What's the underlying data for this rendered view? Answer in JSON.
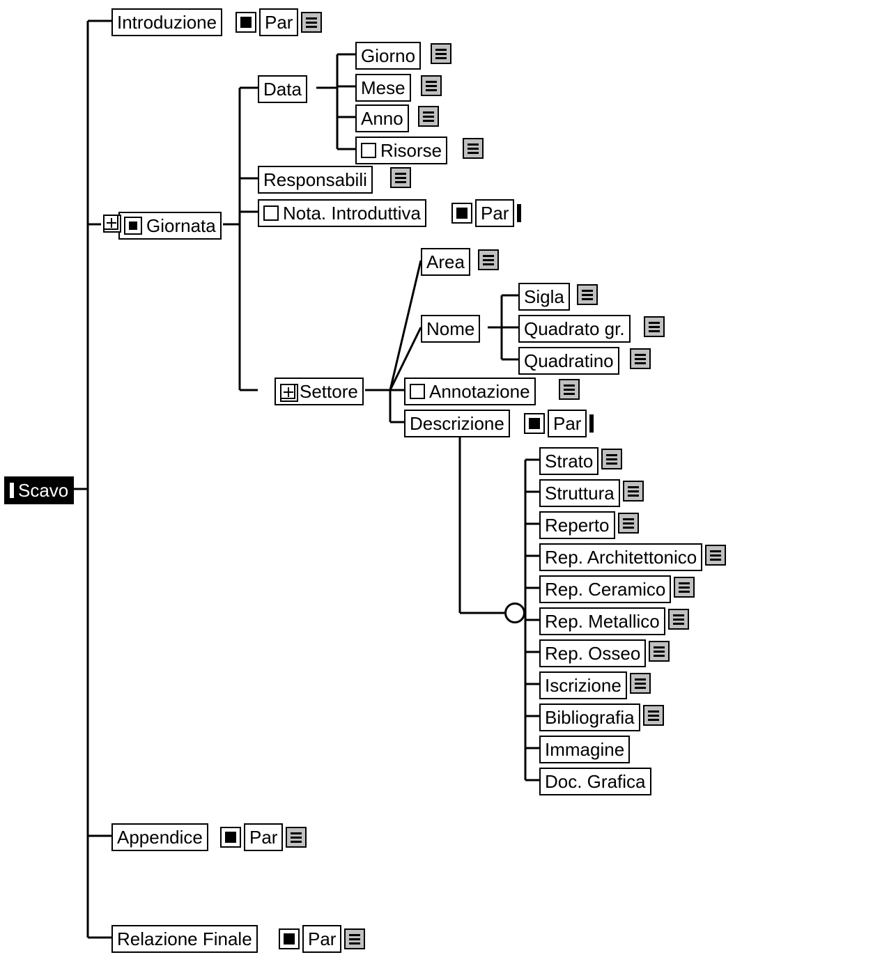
{
  "root": "Scavo",
  "introduzione": {
    "label": "Introduzione",
    "par": "Par"
  },
  "giornata": {
    "label": "Giornata",
    "data": {
      "label": "Data",
      "children": [
        "Giorno",
        "Mese",
        "Anno"
      ],
      "risorse": "Risorse"
    },
    "responsabili": "Responsabili",
    "nota_introduttiva": {
      "label": "Nota. Introduttiva",
      "par": "Par"
    },
    "settore": {
      "label": "Settore",
      "area": "Area",
      "nome": {
        "label": "Nome",
        "children": [
          "Sigla",
          "Quadrato gr.",
          "Quadratino"
        ]
      },
      "annotazione": "Annotazione",
      "descrizione": {
        "label": "Descrizione",
        "par": "Par",
        "choices": [
          "Strato",
          "Struttura",
          "Reperto",
          "Rep. Architettonico",
          "Rep. Ceramico",
          "Rep. Metallico",
          "Rep. Osseo",
          "Iscrizione",
          "Bibliografia",
          "Immagine",
          "Doc. Grafica"
        ],
        "choices_has_list_icon": [
          true,
          true,
          true,
          true,
          true,
          true,
          true,
          true,
          true,
          false,
          false
        ]
      }
    }
  },
  "appendice": {
    "label": "Appendice",
    "par": "Par"
  },
  "relazione_finale": {
    "label": "Relazione Finale",
    "par": "Par"
  },
  "par_label": "Par"
}
